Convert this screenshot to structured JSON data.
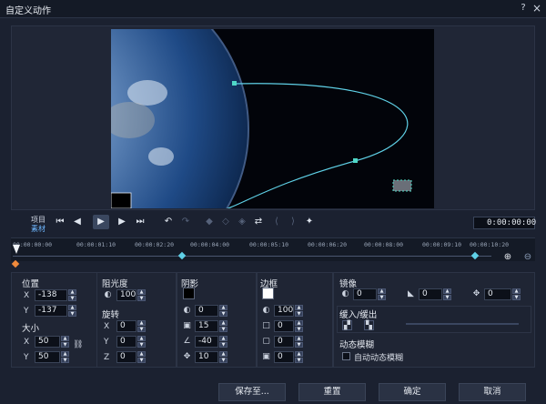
{
  "window": {
    "title": "自定义动作"
  },
  "transport": {
    "project_label": "项目",
    "clip_label": "素材",
    "timecode": "0:00:00:00"
  },
  "ruler": {
    "ticks": [
      "00:00:00:00",
      "00:00:01:10",
      "00:00:02:20",
      "00:00:04:00",
      "00:00:05:10",
      "00:00:06:20",
      "00:00:08:00",
      "00:00:09:10",
      "00:00:10:20"
    ]
  },
  "position": {
    "title": "位置",
    "x_label": "X",
    "x": "-138",
    "y_label": "Y",
    "y": "-137"
  },
  "size": {
    "title": "大小",
    "x_label": "X",
    "x": "50",
    "y_label": "Y",
    "y": "50"
  },
  "opacity": {
    "title": "阻光度",
    "value": "100"
  },
  "rotation": {
    "title": "旋转",
    "x_label": "X",
    "x": "0",
    "y_label": "Y",
    "y": "0",
    "z_label": "Z",
    "z": "0"
  },
  "shadow": {
    "title": "阴影",
    "color": "#000000",
    "opacity": "0",
    "blur": "15",
    "angle": "-40",
    "distance": "10"
  },
  "border": {
    "title": "边框",
    "color": "#ffffff",
    "opacity": "100",
    "width": "0",
    "radius": "0",
    "blur": "0"
  },
  "mirror": {
    "title": "镜像",
    "opacity": "0",
    "angle": "0",
    "offset": "0"
  },
  "ease": {
    "title": "缓入/缓出"
  },
  "motion_blur": {
    "title": "动态模糊",
    "auto_label": "自动动态模糊"
  },
  "buttons": {
    "save": "保存至...",
    "reset": "重置",
    "ok": "确定",
    "cancel": "取消"
  },
  "colors": {
    "accent": "#4fd7c7",
    "background": "#1b2130",
    "keyframe": "#5fd0e6"
  }
}
